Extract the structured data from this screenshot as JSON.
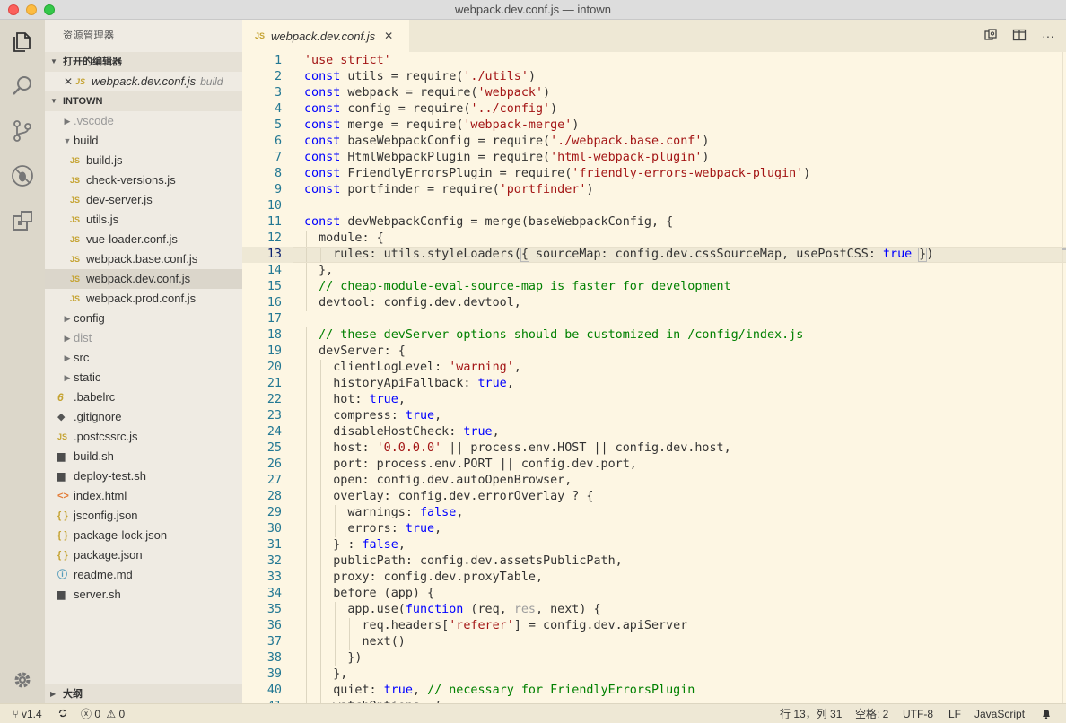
{
  "window": {
    "title": "webpack.dev.conf.js — intown"
  },
  "activity_bar": {
    "items": [
      {
        "name": "explorer-icon",
        "active": true
      },
      {
        "name": "search-icon",
        "active": false
      },
      {
        "name": "source-control-icon",
        "active": false
      },
      {
        "name": "debug-icon",
        "active": false
      },
      {
        "name": "extensions-icon",
        "active": false
      }
    ],
    "bottom": "gear-icon"
  },
  "sidebar": {
    "title": "资源管理器",
    "open_editors": {
      "header": "打开的编辑器",
      "items": [
        {
          "icon": "JS",
          "name": "webpack.dev.conf.js",
          "path": "build"
        }
      ]
    },
    "project": {
      "header": "INTOWN",
      "tree": [
        {
          "label": ".vscode",
          "type": "folder",
          "expanded": false,
          "depth": 0,
          "dim": true
        },
        {
          "label": "build",
          "type": "folder",
          "expanded": true,
          "depth": 0
        },
        {
          "label": "build.js",
          "type": "js",
          "depth": 1
        },
        {
          "label": "check-versions.js",
          "type": "js",
          "depth": 1
        },
        {
          "label": "dev-server.js",
          "type": "js",
          "depth": 1
        },
        {
          "label": "utils.js",
          "type": "js",
          "depth": 1
        },
        {
          "label": "vue-loader.conf.js",
          "type": "js",
          "depth": 1
        },
        {
          "label": "webpack.base.conf.js",
          "type": "js",
          "depth": 1
        },
        {
          "label": "webpack.dev.conf.js",
          "type": "js",
          "depth": 1,
          "selected": true
        },
        {
          "label": "webpack.prod.conf.js",
          "type": "js",
          "depth": 1
        },
        {
          "label": "config",
          "type": "folder",
          "expanded": false,
          "depth": 0
        },
        {
          "label": "dist",
          "type": "folder",
          "expanded": false,
          "depth": 0,
          "dim": true
        },
        {
          "label": "src",
          "type": "folder",
          "expanded": false,
          "depth": 0
        },
        {
          "label": "static",
          "type": "folder",
          "expanded": false,
          "depth": 0
        },
        {
          "label": ".babelrc",
          "type": "babel",
          "depth": 0
        },
        {
          "label": ".gitignore",
          "type": "git",
          "depth": 0
        },
        {
          "label": ".postcssrc.js",
          "type": "js",
          "depth": 0
        },
        {
          "label": "build.sh",
          "type": "sh",
          "depth": 0
        },
        {
          "label": "deploy-test.sh",
          "type": "sh",
          "depth": 0
        },
        {
          "label": "index.html",
          "type": "html",
          "depth": 0
        },
        {
          "label": "jsconfig.json",
          "type": "json",
          "depth": 0
        },
        {
          "label": "package-lock.json",
          "type": "json",
          "depth": 0
        },
        {
          "label": "package.json",
          "type": "json",
          "depth": 0
        },
        {
          "label": "readme.md",
          "type": "md",
          "depth": 0
        },
        {
          "label": "server.sh",
          "type": "sh",
          "depth": 0
        }
      ]
    },
    "outline_header": "大纲"
  },
  "editor": {
    "tab": {
      "icon": "JS",
      "label": "webpack.dev.conf.js"
    },
    "actions": [
      "open-changes-icon",
      "split-editor-icon",
      "more-icon"
    ],
    "current_line": 13,
    "lines": [
      [
        [
          "str",
          "'use strict'"
        ]
      ],
      [
        [
          "kw",
          "const"
        ],
        [
          "t",
          " utils = require("
        ],
        [
          "str",
          "'./utils'"
        ],
        [
          "t",
          ")"
        ]
      ],
      [
        [
          "kw",
          "const"
        ],
        [
          "t",
          " webpack = require("
        ],
        [
          "str",
          "'webpack'"
        ],
        [
          "t",
          ")"
        ]
      ],
      [
        [
          "kw",
          "const"
        ],
        [
          "t",
          " config = require("
        ],
        [
          "str",
          "'../config'"
        ],
        [
          "t",
          ")"
        ]
      ],
      [
        [
          "kw",
          "const"
        ],
        [
          "t",
          " merge = require("
        ],
        [
          "str",
          "'webpack-merge'"
        ],
        [
          "t",
          ")"
        ]
      ],
      [
        [
          "kw",
          "const"
        ],
        [
          "t",
          " baseWebpackConfig = require("
        ],
        [
          "str",
          "'./webpack.base.conf'"
        ],
        [
          "t",
          ")"
        ]
      ],
      [
        [
          "kw",
          "const"
        ],
        [
          "t",
          " HtmlWebpackPlugin = require("
        ],
        [
          "str",
          "'html-webpack-plugin'"
        ],
        [
          "t",
          ")"
        ]
      ],
      [
        [
          "kw",
          "const"
        ],
        [
          "t",
          " FriendlyErrorsPlugin = require("
        ],
        [
          "str",
          "'friendly-errors-webpack-plugin'"
        ],
        [
          "t",
          ")"
        ]
      ],
      [
        [
          "kw",
          "const"
        ],
        [
          "t",
          " portfinder = require("
        ],
        [
          "str",
          "'portfinder'"
        ],
        [
          "t",
          ")"
        ]
      ],
      [],
      [
        [
          "kw",
          "const"
        ],
        [
          "t",
          " devWebpackConfig = merge(baseWebpackConfig, {"
        ]
      ],
      [
        [
          "t",
          "  module: {"
        ]
      ],
      [
        [
          "t",
          "    rules: utils.styleLoaders("
        ],
        [
          "bm",
          "{"
        ],
        [
          "t",
          " sourceMap: config.dev.cssSourceMap, usePostCSS: "
        ],
        [
          "kw",
          "true"
        ],
        [
          "t",
          " "
        ],
        [
          "bm",
          "}"
        ],
        [
          "t",
          ")"
        ]
      ],
      [
        [
          "t",
          "  },"
        ]
      ],
      [
        [
          "t",
          "  "
        ],
        [
          "com",
          "// cheap-module-eval-source-map is faster for development"
        ]
      ],
      [
        [
          "t",
          "  devtool: config.dev.devtool,"
        ]
      ],
      [],
      [
        [
          "t",
          "  "
        ],
        [
          "com",
          "// these devServer options should be customized in /config/index.js"
        ]
      ],
      [
        [
          "t",
          "  devServer: {"
        ]
      ],
      [
        [
          "t",
          "    clientLogLevel: "
        ],
        [
          "str",
          "'warning'"
        ],
        [
          "t",
          ","
        ]
      ],
      [
        [
          "t",
          "    historyApiFallback: "
        ],
        [
          "kw",
          "true"
        ],
        [
          "t",
          ","
        ]
      ],
      [
        [
          "t",
          "    hot: "
        ],
        [
          "kw",
          "true"
        ],
        [
          "t",
          ","
        ]
      ],
      [
        [
          "t",
          "    compress: "
        ],
        [
          "kw",
          "true"
        ],
        [
          "t",
          ","
        ]
      ],
      [
        [
          "t",
          "    disableHostCheck: "
        ],
        [
          "kw",
          "true"
        ],
        [
          "t",
          ","
        ]
      ],
      [
        [
          "t",
          "    host: "
        ],
        [
          "str",
          "'0.0.0.0'"
        ],
        [
          "t",
          " || process.env.HOST || config.dev.host,"
        ]
      ],
      [
        [
          "t",
          "    port: process.env.PORT || config.dev.port,"
        ]
      ],
      [
        [
          "t",
          "    open: config.dev.autoOpenBrowser,"
        ]
      ],
      [
        [
          "t",
          "    overlay: config.dev.errorOverlay ? {"
        ]
      ],
      [
        [
          "t",
          "      warnings: "
        ],
        [
          "kw",
          "false"
        ],
        [
          "t",
          ","
        ]
      ],
      [
        [
          "t",
          "      errors: "
        ],
        [
          "kw",
          "true"
        ],
        [
          "t",
          ","
        ]
      ],
      [
        [
          "t",
          "    } : "
        ],
        [
          "kw",
          "false"
        ],
        [
          "t",
          ","
        ]
      ],
      [
        [
          "t",
          "    publicPath: config.dev.assetsPublicPath,"
        ]
      ],
      [
        [
          "t",
          "    proxy: config.dev.proxyTable,"
        ]
      ],
      [
        [
          "t",
          "    before (app) {"
        ]
      ],
      [
        [
          "t",
          "      app.use("
        ],
        [
          "kw",
          "function"
        ],
        [
          "t",
          " (req, "
        ],
        [
          "dim",
          "res"
        ],
        [
          "t",
          ", next) {"
        ]
      ],
      [
        [
          "t",
          "        req.headers["
        ],
        [
          "str",
          "'referer'"
        ],
        [
          "t",
          "] = config.dev.apiServer"
        ]
      ],
      [
        [
          "t",
          "        next()"
        ]
      ],
      [
        [
          "t",
          "      })"
        ]
      ],
      [
        [
          "t",
          "    },"
        ]
      ],
      [
        [
          "t",
          "    quiet: "
        ],
        [
          "kw",
          "true"
        ],
        [
          "t",
          ", "
        ],
        [
          "com",
          "// necessary for FriendlyErrorsPlugin"
        ]
      ],
      [
        [
          "t",
          "    watchOptions: {"
        ]
      ]
    ]
  },
  "statusbar": {
    "branch": "v1.4",
    "sync": "sync-icon",
    "errors": "0",
    "warnings": "0",
    "position": "行 13，列 31",
    "spaces": "空格: 2",
    "encoding": "UTF-8",
    "eol": "LF",
    "language": "JavaScript"
  }
}
